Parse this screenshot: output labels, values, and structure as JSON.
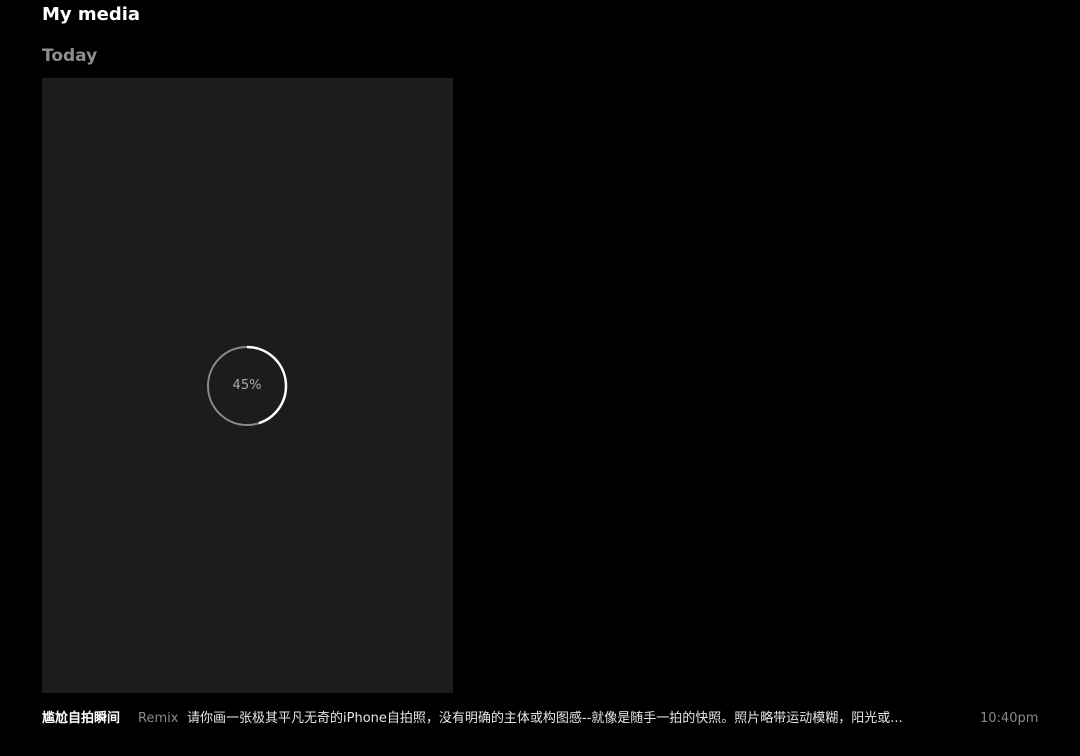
{
  "header": {
    "title": "My media"
  },
  "section": {
    "heading": "Today"
  },
  "media_item": {
    "progress_fraction": 0.45,
    "progress_label": "45%",
    "title": "尴尬自拍瞬间",
    "tag": "Remix",
    "prompt": "请你画一张极其平凡无奇的iPhone自拍照，没有明确的主体或构图感--就像是随手一拍的快照。照片略带运动模糊，阳光或...",
    "time": "10:40pm"
  },
  "colors": {
    "background": "#000000",
    "card": "#1c1c1c",
    "progress_track": "#8a8a8a",
    "progress_fill": "#ffffff",
    "muted_text": "#8e8e8e"
  }
}
